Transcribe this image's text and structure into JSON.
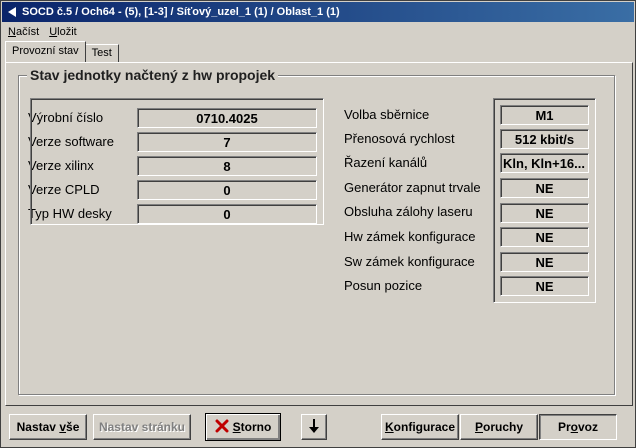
{
  "window": {
    "title": "SOCD č.5 / Och64 - (5), [1-3] / Síťový_uzel_1 (1) / Oblast_1 (1)",
    "icon": "arrow-left-icon"
  },
  "menu": {
    "nacist": {
      "first": "N",
      "rest": "ačíst"
    },
    "ulozit": {
      "first": "U",
      "rest": "ložit"
    }
  },
  "tabs": [
    {
      "label": "Provozní stav",
      "active": true
    },
    {
      "label": "Test",
      "active": false
    }
  ],
  "group": {
    "title": "Stav jednotky načtený z hw propojek"
  },
  "left_fields": [
    {
      "label": "Výrobní číslo",
      "value": "0710.4025"
    },
    {
      "label": "Verze software",
      "value": "7"
    },
    {
      "label": "Verze xilinx",
      "value": "8"
    },
    {
      "label": "Verze CPLD",
      "value": "0"
    },
    {
      "label": "Typ HW desky",
      "value": "0"
    }
  ],
  "right_fields": [
    {
      "label": "Volba sběrnice",
      "value": "M1"
    },
    {
      "label": "Přenosová rychlost",
      "value": "512 kbit/s"
    },
    {
      "label": "Řazení kanálů",
      "value": "Kln, Kln+16..."
    },
    {
      "label": "Generátor zapnut trvale",
      "value": "NE"
    },
    {
      "label": "Obsluha zálohy laseru",
      "value": "NE"
    },
    {
      "label": "Hw zámek konfigurace",
      "value": "NE"
    },
    {
      "label": "Sw zámek konfigurace",
      "value": "NE"
    },
    {
      "label": "Posun pozice",
      "value": "NE"
    }
  ],
  "buttons": {
    "nastav_vse": {
      "before": "Nastav ",
      "u": "v",
      "after": "še"
    },
    "nastav_stranku": {
      "label": "Nastav stránku"
    },
    "storno": {
      "u": "S",
      "after": "torno",
      "icon": "x-cancel-icon"
    },
    "down": {
      "icon": "arrow-down-icon"
    },
    "konfigurace": {
      "u": "K",
      "after": "onfigurace"
    },
    "poruchy": {
      "u": "P",
      "after": "oruchy"
    },
    "provoz": {
      "before": "Pr",
      "u": "o",
      "after": "voz"
    }
  }
}
